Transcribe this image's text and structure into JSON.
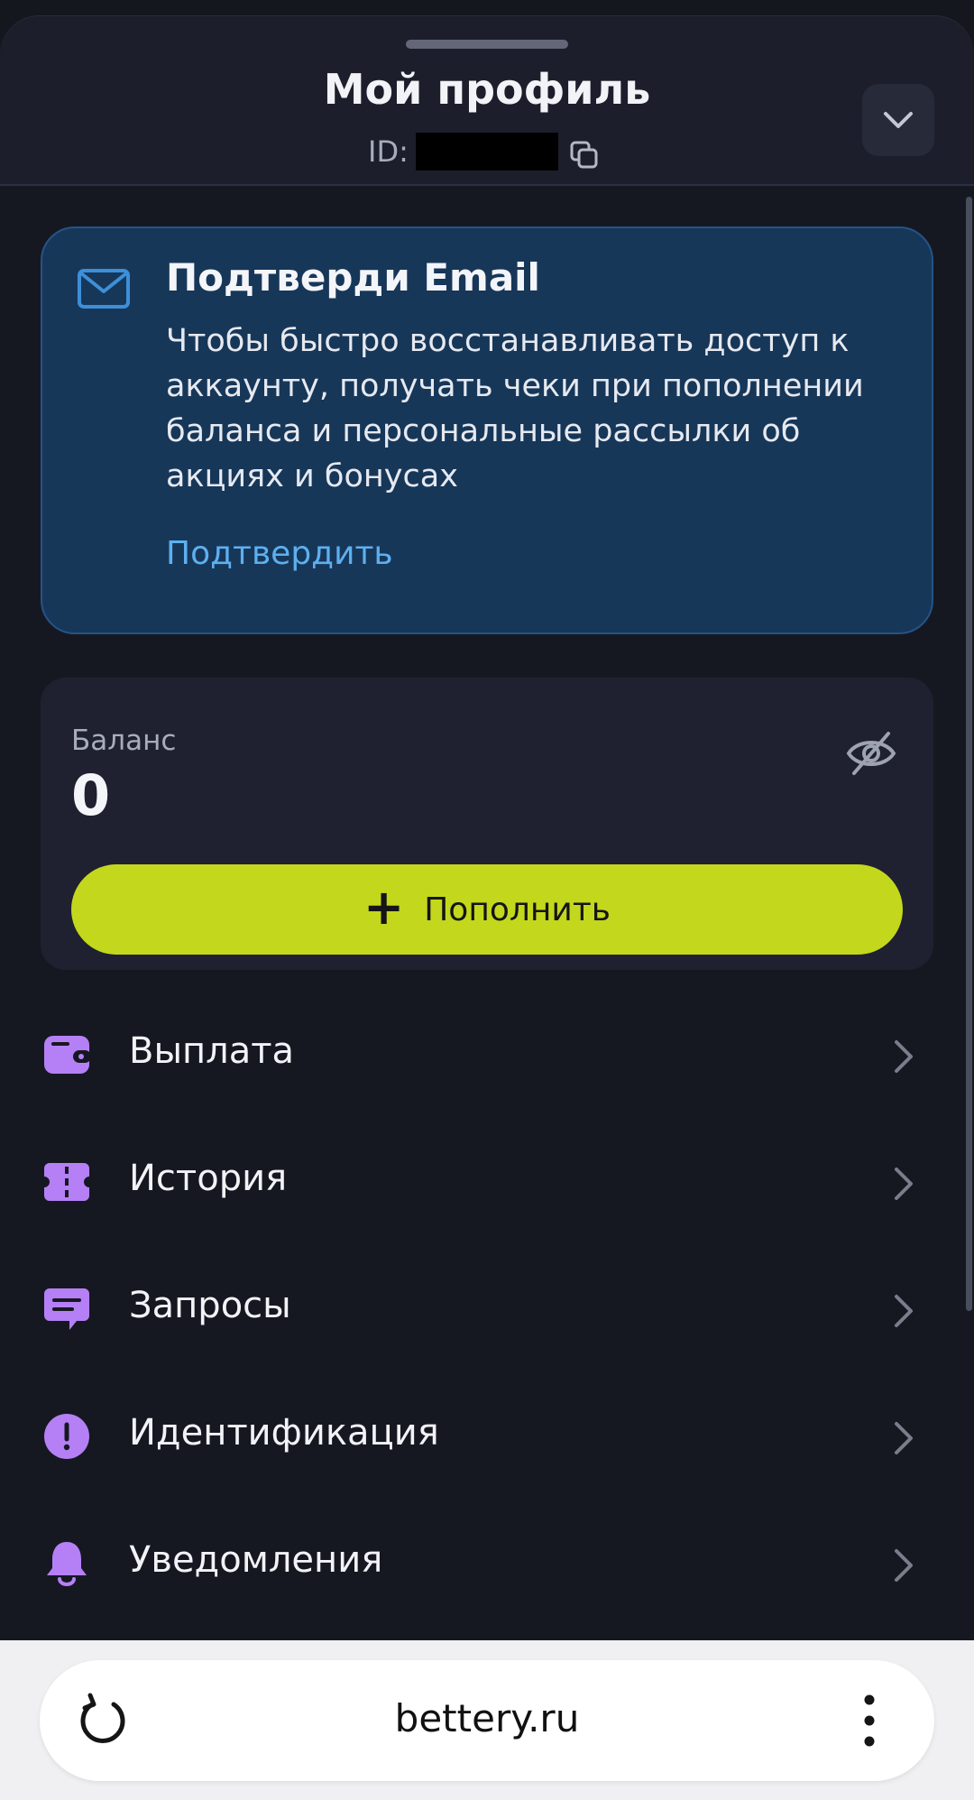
{
  "header": {
    "title": "Мой профиль",
    "id_label": "ID:",
    "icons": {
      "copy": "copy-icon",
      "collapse": "chevron-down-icon"
    }
  },
  "email_card": {
    "title": "Подтверди Email",
    "text": "Чтобы быстро восстанавливать доступ к аккаунту, получать чеки при пополнении баланса и персональные рассылки об акциях и бонусах",
    "action": "Подтвердить",
    "icon": "mail-icon"
  },
  "balance": {
    "label": "Баланс",
    "value": "0",
    "hide_icon": "eye-off-icon",
    "topup_label": "Пополнить",
    "topup_symbol": "+"
  },
  "menu": [
    {
      "label": "Выплата",
      "icon": "wallet-icon"
    },
    {
      "label": "История",
      "icon": "ticket-icon"
    },
    {
      "label": "Запросы",
      "icon": "chat-icon"
    },
    {
      "label": "Идентификация",
      "icon": "alert-icon"
    },
    {
      "label": "Уведомления",
      "icon": "bell-icon"
    }
  ],
  "browser": {
    "url": "bettery.ru",
    "icons": {
      "reload": "reload-icon",
      "more": "more-vertical-icon"
    }
  },
  "colors": {
    "background": "#161821",
    "accent": "#c3d81c",
    "menu_icon": "#b580f5",
    "link": "#5db0f0",
    "email_card": "#173759"
  }
}
